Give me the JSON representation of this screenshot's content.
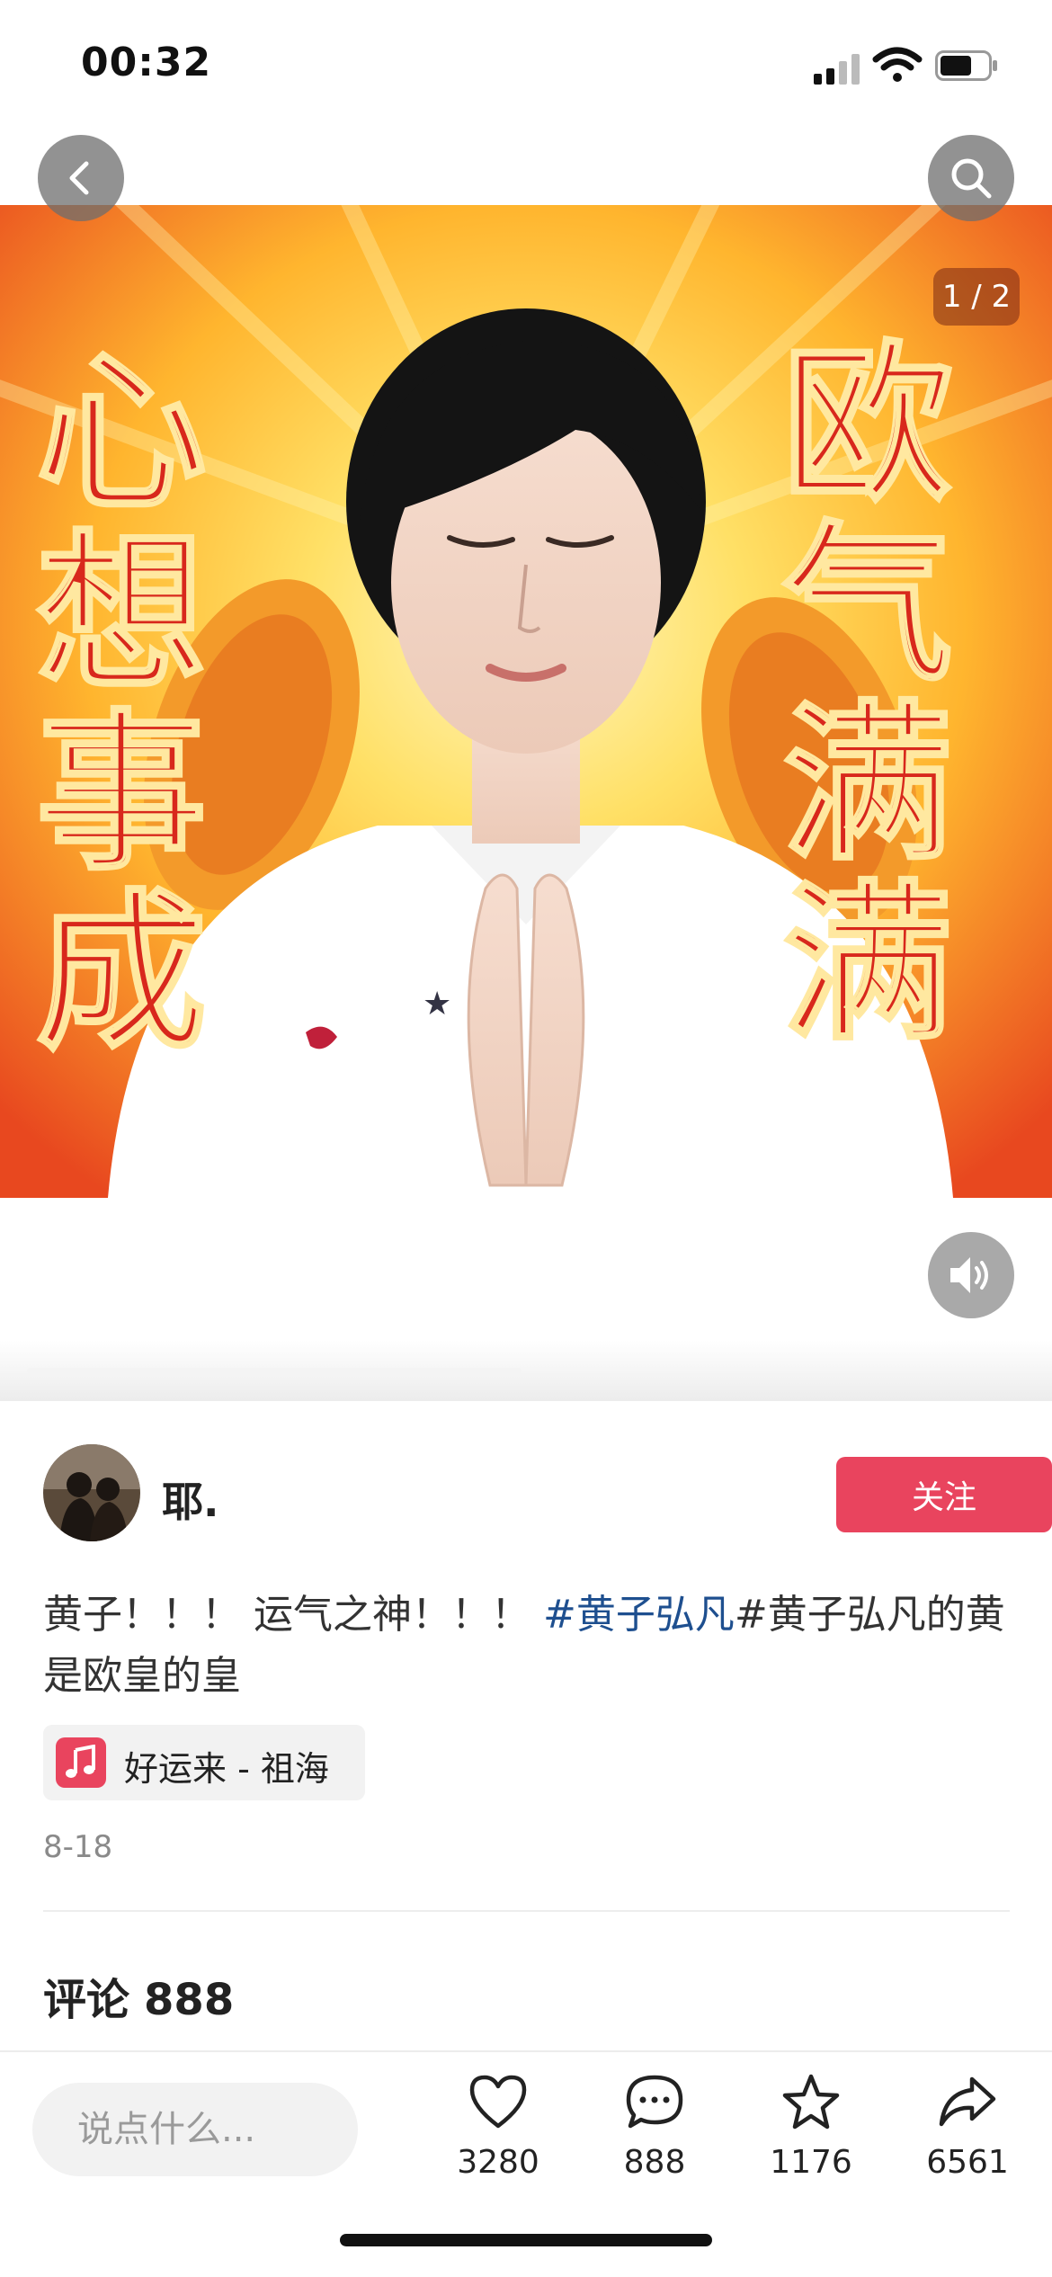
{
  "status_bar": {
    "time": "00:32"
  },
  "media": {
    "page_indicator": "1 / 2",
    "overlay_text_left": [
      "心",
      "想",
      "事",
      "成"
    ],
    "overlay_text_right": [
      "欧",
      "气",
      "满",
      "满"
    ],
    "colors": {
      "background_outer": "#e8481f",
      "background_glow": "#ffe066",
      "text_red": "#d8281c"
    }
  },
  "author": {
    "name": "耶.",
    "follow_label": "关注"
  },
  "caption": {
    "text_before": "黄子！！！ 运气之神！！！ ",
    "hashtag": "#黄子弘凡",
    "text_after": "#黄子弘凡的黄是欧皇的皇"
  },
  "music": {
    "label": "好运来 - 祖海"
  },
  "post": {
    "date": "8-18"
  },
  "comments": {
    "label": "评论",
    "count": "888"
  },
  "bottom_bar": {
    "input_placeholder": "说点什么...",
    "likes": "3280",
    "comments": "888",
    "favorites": "1176",
    "shares": "6561"
  },
  "colors": {
    "accent": "#e9445e",
    "hashtag": "#1e4f8f"
  }
}
